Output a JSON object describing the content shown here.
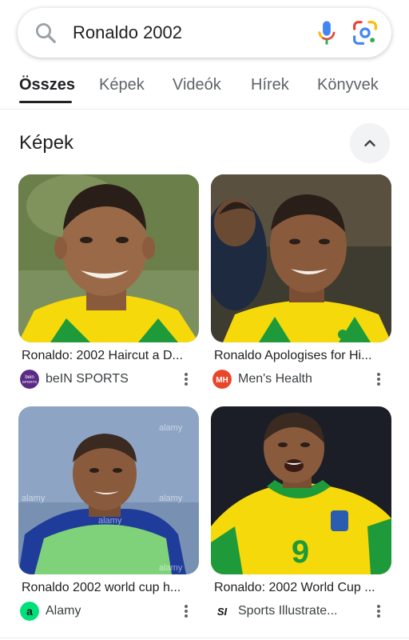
{
  "search": {
    "query": "Ronaldo 2002"
  },
  "tabs": [
    {
      "label": "Összes",
      "active": true
    },
    {
      "label": "Képek"
    },
    {
      "label": "Videók"
    },
    {
      "label": "Hírek"
    },
    {
      "label": "Könyvek"
    }
  ],
  "section": {
    "title": "Képek"
  },
  "results": [
    {
      "title": "Ronaldo: 2002 Haircut a D...",
      "source": "beIN SPORTS",
      "logo_text": "bein\nSPORTS"
    },
    {
      "title": "Ronaldo Apologises for Hi...",
      "source": "Men's Health",
      "logo_text": "MH"
    },
    {
      "title": "Ronaldo 2002 world cup h...",
      "source": "Alamy",
      "logo_text": "a"
    },
    {
      "title": "Ronaldo: 2002 World Cup ...",
      "source": "Sports Illustrate...",
      "logo_text": "SI"
    }
  ],
  "watermark": "alamy",
  "jersey_number": "9",
  "colors": {
    "brazil_yellow": "#f5d90a",
    "brazil_green": "#1f9a3a",
    "mh_red": "#e8472b",
    "alamy_green": "#00e07a",
    "bein_purple": "#5b2a86"
  }
}
